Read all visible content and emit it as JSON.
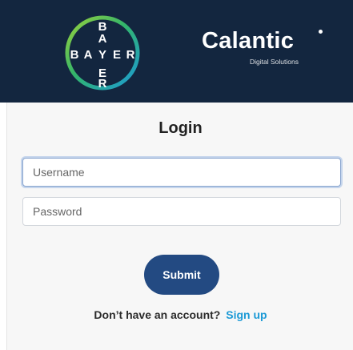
{
  "header": {
    "bayer_logo_letters_vertical": [
      "B",
      "A",
      "Y",
      "E",
      "R"
    ],
    "bayer_logo_letters_horizontal": [
      "B",
      "A",
      "Y",
      "E",
      "R"
    ],
    "partner_name": "Calantic",
    "partner_tagline": "Digital Solutions",
    "background_color": "#13263f"
  },
  "login": {
    "title": "Login",
    "username_placeholder": "Username",
    "password_placeholder": "Password",
    "submit_label": "Submit",
    "signup_prompt": "Don’t have an account?",
    "signup_link": "Sign up",
    "accent_color": "#234a82",
    "link_color": "#1c9ad6"
  }
}
